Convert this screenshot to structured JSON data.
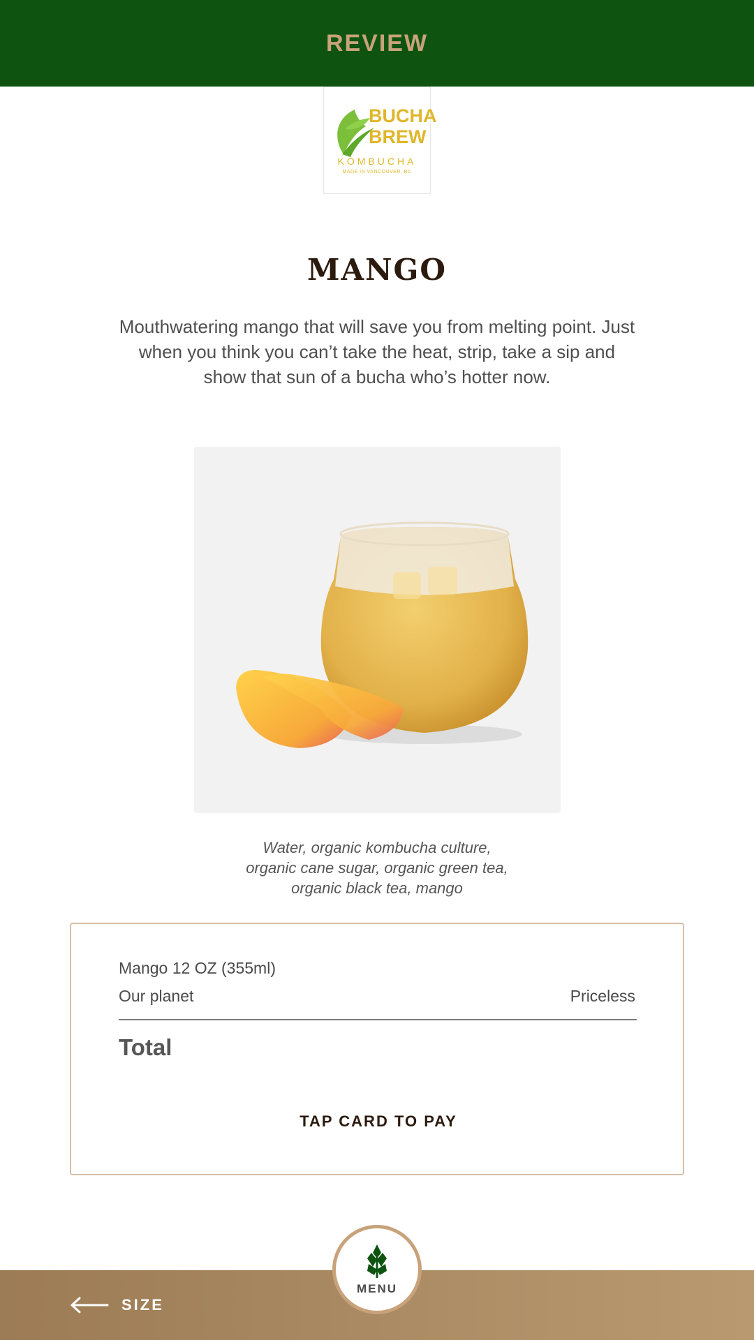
{
  "header": {
    "title": "REVIEW"
  },
  "logo": {
    "line1": "BUCHA",
    "line2": "BREW",
    "line3": "KOMBUCHA",
    "line4": "MADE IN VANCOUVER, BC",
    "icon": "leaf-icon"
  },
  "product": {
    "name": "MANGO",
    "description": "Mouthwatering mango that will save you from melting point. Just when you think you can’t take the heat, strip, take a sip and show that sun of a bucha who’s hotter now.",
    "ingredients": [
      "Water, organic kombucha culture,",
      "organic cane sugar, organic green tea,",
      "organic black tea, mango"
    ]
  },
  "order": {
    "item": "Mango 12 OZ (355ml)",
    "sub_label": "Our planet",
    "sub_value": "Priceless",
    "total_label": "Total",
    "pay_label": "TAP CARD TO PAY"
  },
  "footer": {
    "back_label": "SIZE",
    "back_icon": "arrow-left-icon",
    "menu_label": "MENU",
    "menu_icon": "plant-icon"
  },
  "colors": {
    "header_bg": "#0e5410",
    "accent": "#c8a27a",
    "footer_bg": "#a98a63",
    "title_text": "#2b1a0e"
  }
}
